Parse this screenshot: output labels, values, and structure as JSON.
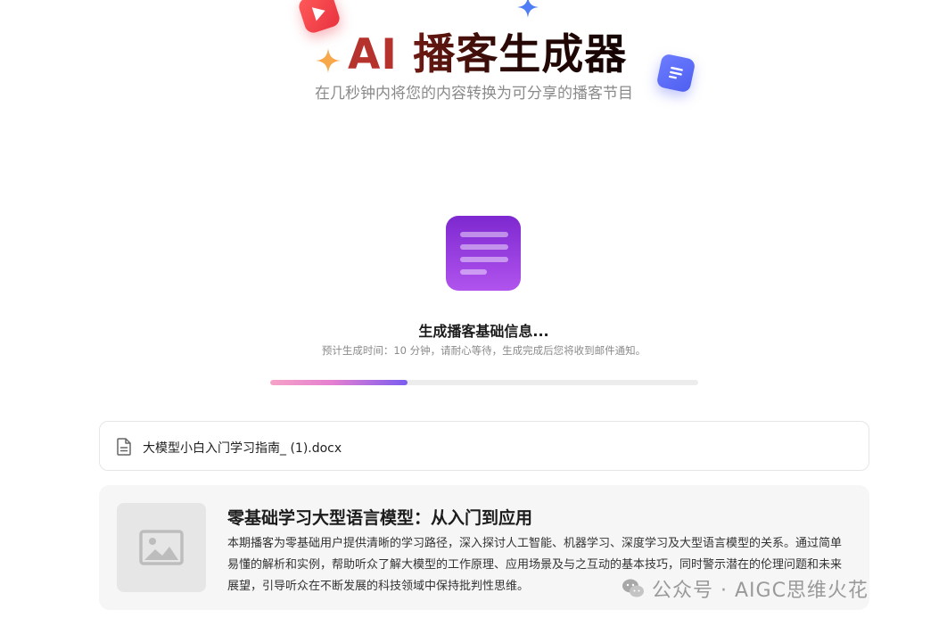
{
  "header": {
    "title_ai": "AI",
    "title_rest": "播客生成器",
    "subtitle": "在几秒钟内将您的内容转换为可分享的播客节目"
  },
  "decorations": {
    "play_icon": "play-icon",
    "star_blue_icon": "sparkle-icon",
    "star_orange_icon": "sparkle-icon",
    "doc_icon": "document-icon"
  },
  "status": {
    "title": "生成播客基础信息...",
    "subtitle": "预计生成时间：10 分钟，请耐心等待，生成完成后您将收到邮件通知。",
    "progress_percent": 32
  },
  "file": {
    "name": "大模型小白入门学习指南_ (1).docx"
  },
  "episode": {
    "title": "零基础学习大型语言模型：从入门到应用",
    "description": "本期播客为零基础用户提供清晰的学习路径，深入探讨人工智能、机器学习、深度学习及大型语言模型的关系。通过简单易懂的解析和实例，帮助听众了解大模型的工作原理、应用场景及与之互动的基本技巧，同时警示潜在的伦理问题和未来展望，引导听众在不断发展的科技领域中保持批判性思维。"
  },
  "watermark": {
    "text": "公众号 · AIGC思维火花"
  },
  "colors": {
    "title_ai": "#b5332c",
    "title_rest": "#2a0b08",
    "accent_purple": "#8b3ae0",
    "progress_start": "#f5a3c8",
    "progress_end": "#7a5cf0"
  }
}
